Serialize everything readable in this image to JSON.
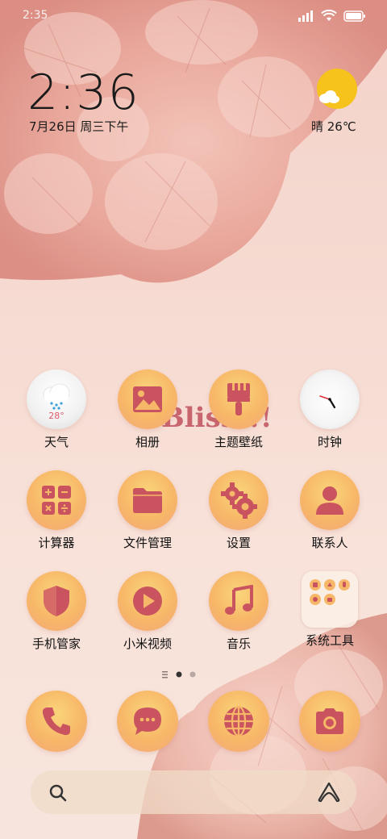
{
  "status_bar": {
    "time": "2:35"
  },
  "clock": {
    "time": "2:36",
    "date": "7月26日 周三下午"
  },
  "weather": {
    "text": "晴 26℃"
  },
  "wallpaper": {
    "text": "Bliss!!!"
  },
  "widgets": {
    "weather_app_temp": "28°"
  },
  "apps": [
    {
      "label": "天气"
    },
    {
      "label": "相册"
    },
    {
      "label": "主题壁纸"
    },
    {
      "label": "时钟"
    },
    {
      "label": "计算器"
    },
    {
      "label": "文件管理"
    },
    {
      "label": "设置"
    },
    {
      "label": "联系人"
    },
    {
      "label": "手机管家"
    },
    {
      "label": "小米视频"
    },
    {
      "label": "音乐"
    },
    {
      "label": "系统工具"
    }
  ],
  "colors": {
    "icon_fill": "#c9545f",
    "icon_bg": "#f7b768",
    "accent_sun": "#f6c21c"
  }
}
